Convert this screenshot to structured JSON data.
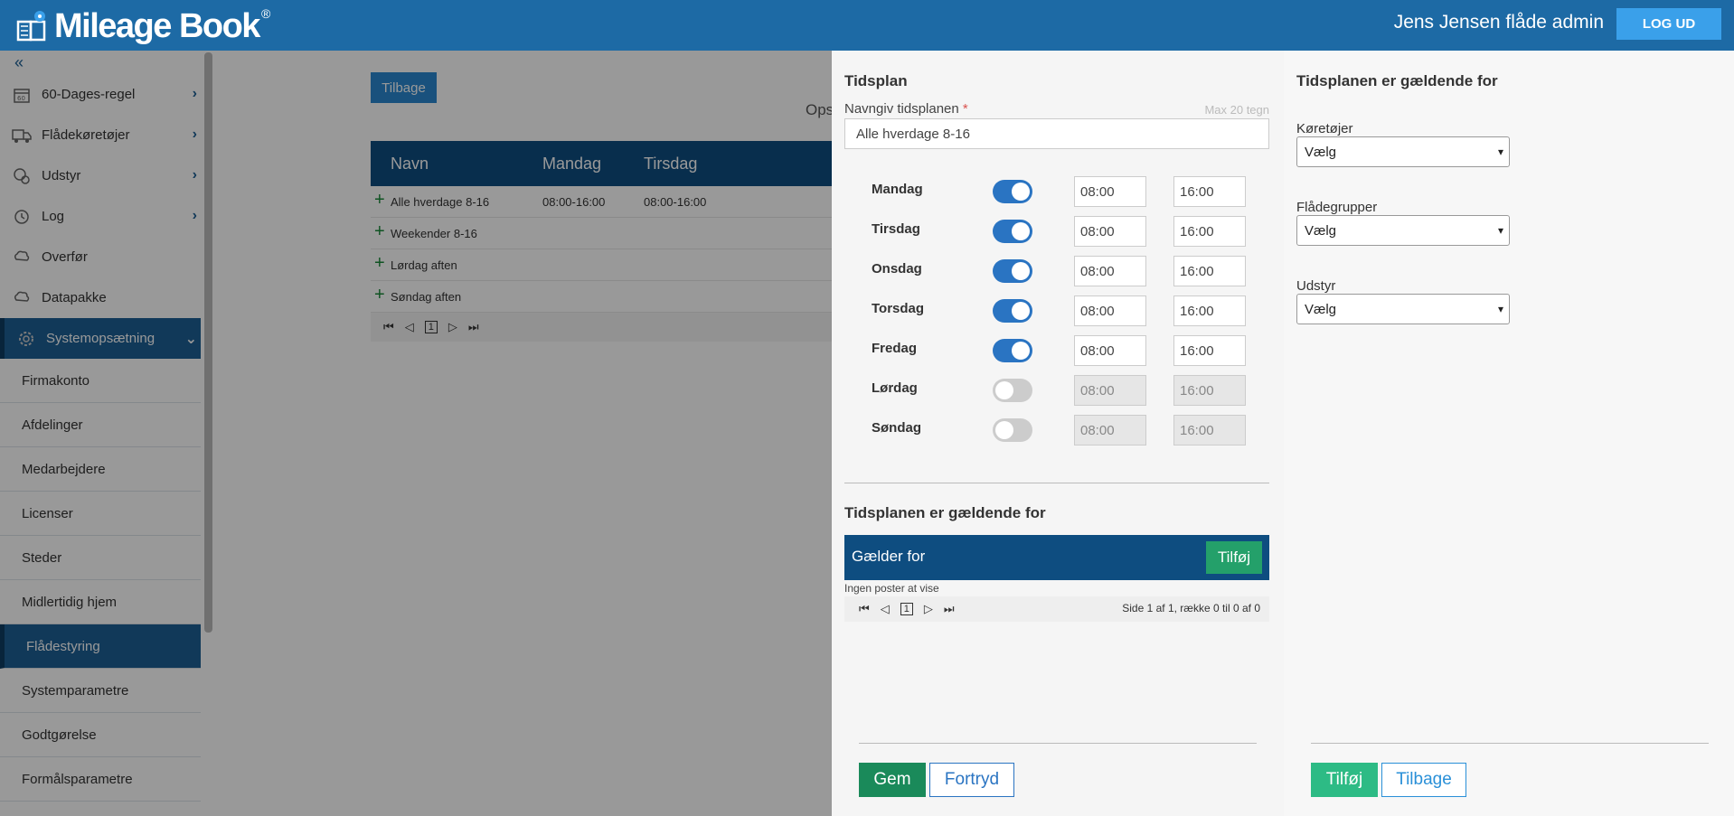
{
  "app": {
    "title": "Mileage Book",
    "reg_mark": "®"
  },
  "header": {
    "user": "Jens Jensen flåde admin",
    "logout": "LOG UD"
  },
  "sidebar": {
    "collapse_icon": "«",
    "items": [
      {
        "label": "60-Dages-regel",
        "icon": "calendar-icon"
      },
      {
        "label": "Flådekøretøjer",
        "icon": "truck-icon"
      },
      {
        "label": "Udstyr",
        "icon": "equipment-icon"
      },
      {
        "label": "Log",
        "icon": "history-icon"
      },
      {
        "label": "Overfør",
        "icon": "transfer-icon"
      },
      {
        "label": "Datapakke",
        "icon": "datapackage-icon"
      },
      {
        "label": "Systemopsætning",
        "icon": "gear-icon"
      }
    ],
    "subitems": [
      "Firmakonto",
      "Afdelinger",
      "Medarbejdere",
      "Licenser",
      "Steder",
      "Midlertidig hjem",
      "Flådestyring",
      "Systemparametre",
      "Godtgørelse",
      "Formålsparametre"
    ]
  },
  "main": {
    "back": "Tilbage",
    "ops": "Ops",
    "columns": [
      "Navn",
      "Mandag",
      "Tirsdag"
    ],
    "rows": [
      {
        "name": "Alle hverdage 8-16",
        "mon": "08:00-16:00",
        "tue": "08:00-16:00"
      },
      {
        "name": "Weekender 8-16",
        "mon": "",
        "tue": ""
      },
      {
        "name": "Lørdag aften",
        "mon": "",
        "tue": ""
      },
      {
        "name": "Søndag aften",
        "mon": "",
        "tue": ""
      }
    ],
    "page": "1"
  },
  "schedule": {
    "title": "Tidsplan",
    "name_label": "Navngiv tidsplanen",
    "required_mark": "*",
    "max_note": "Max 20 tegn",
    "name_value": "Alle hverdage 8-16",
    "days": [
      {
        "name": "Mandag",
        "on": true,
        "from": "08:00",
        "to": "16:00"
      },
      {
        "name": "Tirsdag",
        "on": true,
        "from": "08:00",
        "to": "16:00"
      },
      {
        "name": "Onsdag",
        "on": true,
        "from": "08:00",
        "to": "16:00"
      },
      {
        "name": "Torsdag",
        "on": true,
        "from": "08:00",
        "to": "16:00"
      },
      {
        "name": "Fredag",
        "on": true,
        "from": "08:00",
        "to": "16:00"
      },
      {
        "name": "Lørdag",
        "on": false,
        "from": "08:00",
        "to": "16:00"
      },
      {
        "name": "Søndag",
        "on": false,
        "from": "08:00",
        "to": "16:00"
      }
    ],
    "applies_title": "Tidsplanen er gældende for",
    "applies_col": "Gælder for",
    "add": "Tilføj",
    "no_records": "Ingen poster at vise",
    "page": "1",
    "page_info": "Side 1 af 1, række 0 til 0 af 0",
    "save": "Gem",
    "cancel": "Fortryd"
  },
  "applies_panel": {
    "title": "Tidsplanen er gældende for",
    "fields": [
      {
        "label": "Køretøjer",
        "value": "Vælg"
      },
      {
        "label": "Flådegrupper",
        "value": "Vælg"
      },
      {
        "label": "Udstyr",
        "value": "Vælg"
      }
    ],
    "add": "Tilføj",
    "back": "Tilbage"
  },
  "colors": {
    "header": "#1d6aa5",
    "nav_active": "#1d5f94",
    "toggle_on": "#2a74c2",
    "green": "#24a06a"
  }
}
